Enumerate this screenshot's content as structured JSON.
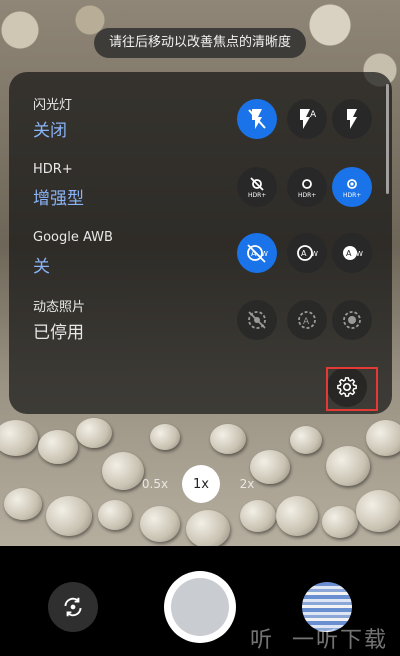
{
  "hint": "请往后移动以改善焦点的清晰度",
  "settings": [
    {
      "title": "闪光灯",
      "value": "关闭",
      "value_active": true,
      "options": [
        {
          "icon": "flash-off-icon",
          "selected": true
        },
        {
          "icon": "flash-auto-icon",
          "selected": false
        },
        {
          "icon": "flash-on-icon",
          "selected": false
        }
      ]
    },
    {
      "title": "HDR+",
      "value": "增强型",
      "value_active": true,
      "options": [
        {
          "icon": "hdr-off-icon",
          "selected": false
        },
        {
          "icon": "hdr-plus-icon",
          "selected": false
        },
        {
          "icon": "hdr-enhanced-icon",
          "selected": true
        }
      ]
    },
    {
      "title": "Google AWB",
      "value": "关",
      "value_active": true,
      "options": [
        {
          "icon": "awb-off-icon",
          "selected": true
        },
        {
          "icon": "awb-auto-icon",
          "selected": false
        },
        {
          "icon": "awb-on-icon",
          "selected": false
        }
      ]
    },
    {
      "title": "动态照片",
      "value": "已停用",
      "value_active": false,
      "options": [
        {
          "icon": "motion-off-icon",
          "selected": false
        },
        {
          "icon": "motion-auto-icon",
          "selected": false
        },
        {
          "icon": "motion-on-icon",
          "selected": false
        }
      ]
    }
  ],
  "zoom": {
    "left": "0.5x",
    "current": "1x",
    "right": "2x"
  },
  "watermark": {
    "icon": "听",
    "text": "一听下载"
  },
  "colors": {
    "accent": "#1a73e8",
    "value_blue": "#8ab4f8",
    "highlight": "#e53935"
  }
}
